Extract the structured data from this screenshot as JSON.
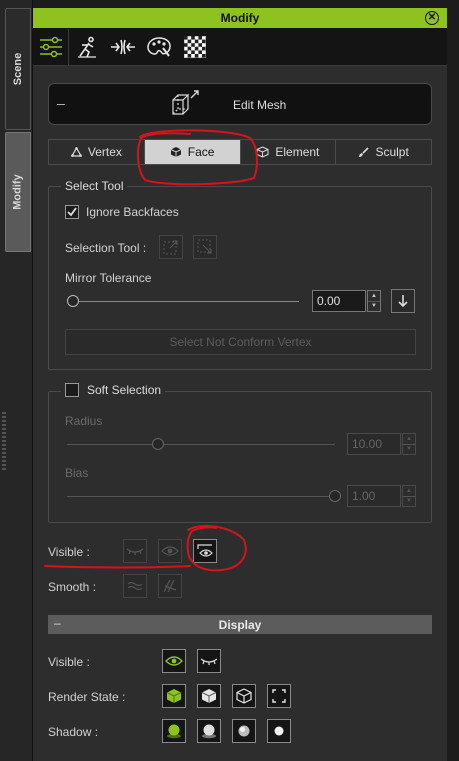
{
  "side_tabs": [
    {
      "label": "Scene"
    },
    {
      "label": "Modify"
    }
  ],
  "panel": {
    "title": "Modify",
    "close_icon": "close-circle-icon",
    "toolbar_icons": [
      "sliders-icon",
      "pose-figure-icon",
      "morph-arrows-icon",
      "palette-icon",
      "checker-texture-icon"
    ]
  },
  "edit_mesh": {
    "collapse": "–",
    "icon": "mesh-cube-icon",
    "label": "Edit Mesh"
  },
  "mode_tabs": [
    {
      "label": "Vertex",
      "icon": "vertex-icon",
      "active": false
    },
    {
      "label": "Face",
      "icon": "face-cube-icon",
      "active": true
    },
    {
      "label": "Element",
      "icon": "element-cube-icon",
      "active": false
    },
    {
      "label": "Sculpt",
      "icon": "brush-icon",
      "active": false
    }
  ],
  "select_tool": {
    "title": "Select Tool",
    "ignore_backfaces": {
      "label": "Ignore Backfaces",
      "checked": true
    },
    "selection_tool_label": "Selection Tool :",
    "mirror_tolerance": {
      "label": "Mirror Tolerance",
      "value": "0.00",
      "slider_fraction": 0.0
    },
    "select_not_conform": "Select Not Conform Vertex"
  },
  "soft_selection": {
    "title": "Soft Selection",
    "checked": false,
    "radius": {
      "label": "Radius",
      "value": "10.00",
      "slider_fraction": 0.34
    },
    "bias": {
      "label": "Bias",
      "value": "1.00",
      "slider_fraction": 1.0
    }
  },
  "visibility": {
    "visible_label": "Visible :",
    "smooth_label": "Smooth :"
  },
  "display": {
    "collapse": "–",
    "title": "Display",
    "visible_label": "Visible :",
    "render_state_label": "Render State  :",
    "shadow_label": "Shadow :"
  },
  "colors": {
    "accent": "#8dc21f",
    "annotation": "#d4141c",
    "panel": "#2d2d2d"
  }
}
